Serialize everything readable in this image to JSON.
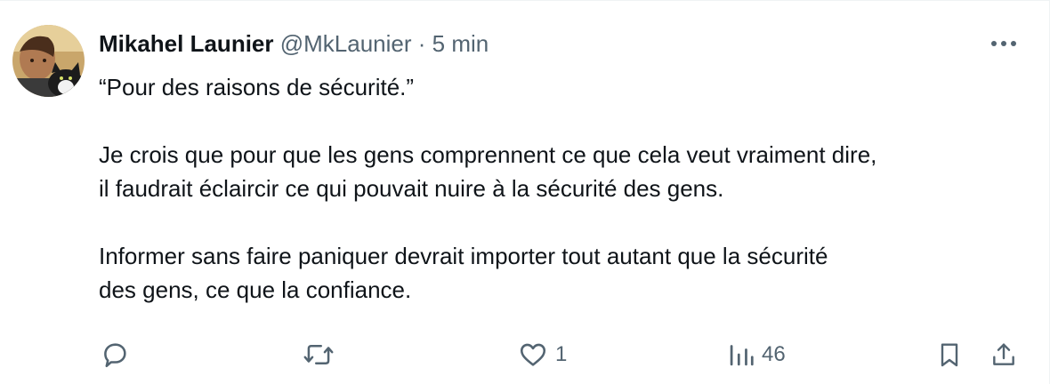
{
  "tweet": {
    "author_name": "Mikahel Launier",
    "author_handle": "@MkLaunier",
    "separator": "·",
    "timestamp": "5 min",
    "paragraphs": [
      [
        "“Pour des raisons de sécurité.”"
      ],
      [
        "Je crois que pour que les gens comprennent ce que cela veut vraiment dire,",
        "il faudrait éclaircir ce qui pouvait nuire à la sécurité des gens."
      ],
      [
        "Informer sans faire paniquer devrait importer tout autant que la sécurité",
        "des gens, ce que la confiance."
      ]
    ],
    "actions": {
      "replies": "",
      "reposts": "",
      "likes": "1",
      "views": "46"
    }
  },
  "icons": {
    "avatar": "avatar-photo",
    "more": "more-horizontal-icon",
    "reply": "reply-bubble-icon",
    "repost": "repost-arrows-icon",
    "like": "heart-icon",
    "views": "bar-chart-icon",
    "bookmark": "bookmark-icon",
    "share": "share-upload-icon"
  },
  "colors": {
    "text_primary": "#0f1419",
    "text_secondary": "#536471",
    "border": "#eff3f4"
  }
}
